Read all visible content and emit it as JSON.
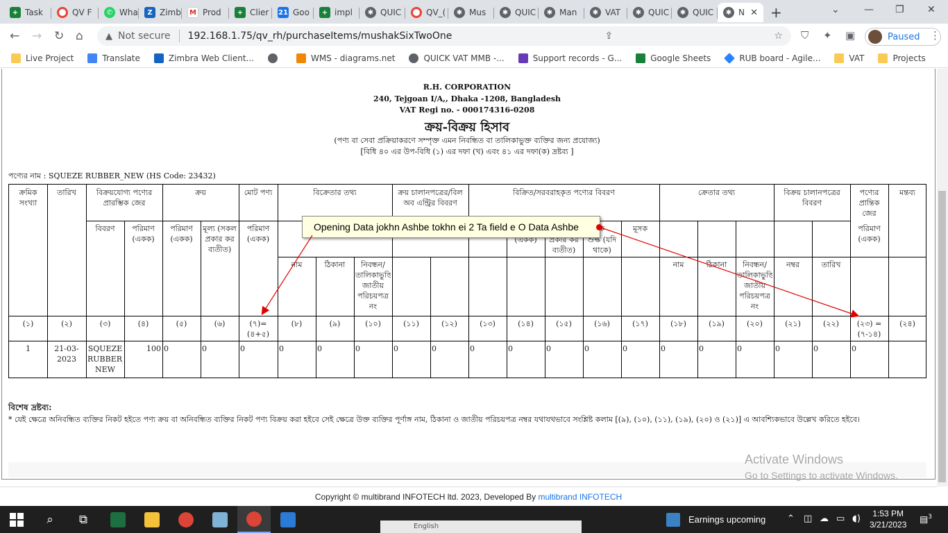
{
  "tabs": [
    {
      "label": "Task",
      "icon": "sheets-icon"
    },
    {
      "label": "QV F",
      "icon": "qv-icon"
    },
    {
      "label": "Wha",
      "icon": "whatsapp-icon"
    },
    {
      "label": "Zimb",
      "icon": "zimbra-icon"
    },
    {
      "label": "Prod",
      "icon": "gmail-icon"
    },
    {
      "label": "Clier",
      "icon": "sheets-icon"
    },
    {
      "label": "Goo",
      "icon": "calendar-icon"
    },
    {
      "label": "impl",
      "icon": "sheets-icon"
    },
    {
      "label": "QUIC",
      "icon": "gear-icon"
    },
    {
      "label": "QV_(",
      "icon": "qv-icon"
    },
    {
      "label": "Mus",
      "icon": "gear-icon"
    },
    {
      "label": "QUIC",
      "icon": "gear-icon"
    },
    {
      "label": "Man",
      "icon": "gear-icon"
    },
    {
      "label": "VAT",
      "icon": "gear-icon"
    },
    {
      "label": "QUIC",
      "icon": "gear-icon"
    },
    {
      "label": "QUIC",
      "icon": "gear-icon"
    },
    {
      "label": "N",
      "icon": "gear-icon",
      "active": true
    }
  ],
  "address": {
    "security": "Not secure",
    "url": "192.168.1.75/qv_rh/purchaseItems/mushakSixTwoOne"
  },
  "profile": {
    "status": "Paused"
  },
  "bookmarks": [
    {
      "label": "Live Project",
      "icon": "folder"
    },
    {
      "label": "Translate",
      "icon": "tr"
    },
    {
      "label": "Zimbra Web Client...",
      "icon": "zm"
    },
    {
      "label": "",
      "icon": "glob"
    },
    {
      "label": "WMS - diagrams.net",
      "icon": "dia"
    },
    {
      "label": "QUICK VAT MMB -...",
      "icon": "gear"
    },
    {
      "label": "Support records - G...",
      "icon": "sr"
    },
    {
      "label": "Google Sheets",
      "icon": "gs"
    },
    {
      "label": "RUB board - Agile...",
      "icon": "rub"
    },
    {
      "label": "VAT",
      "icon": "folder"
    },
    {
      "label": "Projects",
      "icon": "folder"
    }
  ],
  "report": {
    "company": "R.H. CORPORATION",
    "address": "240, Tejgoan I/A,, Dhaka -1208, Bangladesh",
    "vat": "VAT Regi no. - 000174316-0208",
    "title": "ক্রয়-বিক্রয় হিসাব",
    "subtitle1": "(পণ্য বা সেবা প্রক্রিয়াকরণে সম্পৃক্ত এমন নিবন্ধিত বা তালিকাভুক্ত ব্যক্তির জন্য প্রযোজ্য)",
    "subtitle2": "[বিধি ৪০ এর উপ-বিধি (১) এর দফা (খ) এবং ৪১ এর দফা(ক) দ্রষ্টব্য ]",
    "product_line": "পণ্যের নাম : SQUEZE RUBBER_NEW (HS Code: 23432)",
    "headers": {
      "serial": "ক্রমিক সংখ্যা",
      "date": "তারিখ",
      "opening": "বিক্রয়যোগ্য পণ্যের প্রারম্ভিক জের",
      "purchase": "ক্রয়",
      "total": "মোট পণ্য",
      "seller": "বিক্রেতার তথ্য",
      "pinvoice": "ক্রয় চালানপত্রের/বিল অব এন্ট্রির বিবরণ",
      "sold": "বিক্রিত/সরবরাহকৃত পণ্যের বিবরণ",
      "buyer": "ক্রেতার তথ্য",
      "sinvoice": "বিক্রয় চালানপত্রের বিবরণ",
      "closing": "পণ্যের প্রান্তিক জের",
      "remarks": "মন্তব্য",
      "desc": "বিবরণ",
      "qty_unit": "পরিমাণ (একক)",
      "value_excl": "মূল্য (সকল প্রকার কর ব্যতীত)",
      "qty_unit_s": "(একক)",
      "value_excl_s": "প্রকার কর ব্যতীত)",
      "sd_frag": "শুল্ক (যদি থাকে)",
      "sd_frag_top": "ক",
      "vat_col": "মূসক",
      "name": "নাম",
      "place": "ঠিকানা",
      "reg": "নিবন্ধন/ তালিকাভুক্তি/ জাতীয় পরিচয়পত্র নং",
      "number": "নম্বর",
      "sdate": "তারিখ"
    },
    "col_numbers": [
      "(১)",
      "(২)",
      "(৩)",
      "(৪)",
      "(৫)",
      "(৬)",
      "(৭)=(৪+৫)",
      "(৮)",
      "(৯)",
      "(১০)",
      "(১১)",
      "(১২)",
      "(১৩)",
      "(১৪)",
      "(১৫)",
      "(১৬)",
      "(১৭)",
      "(১৮)",
      "(১৯)",
      "(২০)",
      "(২১)",
      "(২২)",
      "(২৩) = (৭-১৪)",
      "(২৪)"
    ],
    "row": [
      "1",
      "21-03-2023",
      "SQUEZE RUBBER_ NEW",
      "100",
      "0",
      "0",
      "0",
      "0",
      "0",
      "0",
      "0",
      "0",
      "0",
      "0",
      "0",
      "0",
      "0",
      "0",
      "0",
      "0",
      "0",
      "0",
      "0",
      ""
    ],
    "notes_title": "বিশেষ দ্রষ্টব্য:",
    "notes_body": "* যেই ক্ষেত্রে অনিবন্ধিত ব্যক্তির নিকট হইতে পণ্য ক্রয় বা অনিবন্ধিত ব্যক্তির নিকট পণ্য বিক্রয় করা হইবে সেই ক্ষেত্রে উক্ত ব্যক্তির পূর্ণাঙ্গ নাম, ঠিকানা ও জাতীয় পরিচয়পত্র নম্বর যথাযথভাবে সংশ্লিষ্ট কলাম [(৯), (১০), (১১), (১৯), (২০) ও (২১)] এ আবশ্যিকভাবে উল্লেখ করিতে হইবে।"
  },
  "annotation": {
    "text": "Opening Data jokhn Ashbe tokhn ei 2 Ta field e O Data Ashbe",
    "color": "#e00000"
  },
  "watermark": {
    "line1": "Activate Windows",
    "line2": "Go to Settings to activate Windows."
  },
  "copyright": {
    "text": "Copyright © multibrand INFOTECH ltd. 2023, Developed By",
    "link": "multibrand INFOTECH"
  },
  "taskbar": {
    "news": "Earnings upcoming",
    "time": "1:53 PM",
    "date": "3/21/2023",
    "notif_count": "3",
    "ime": "English"
  }
}
